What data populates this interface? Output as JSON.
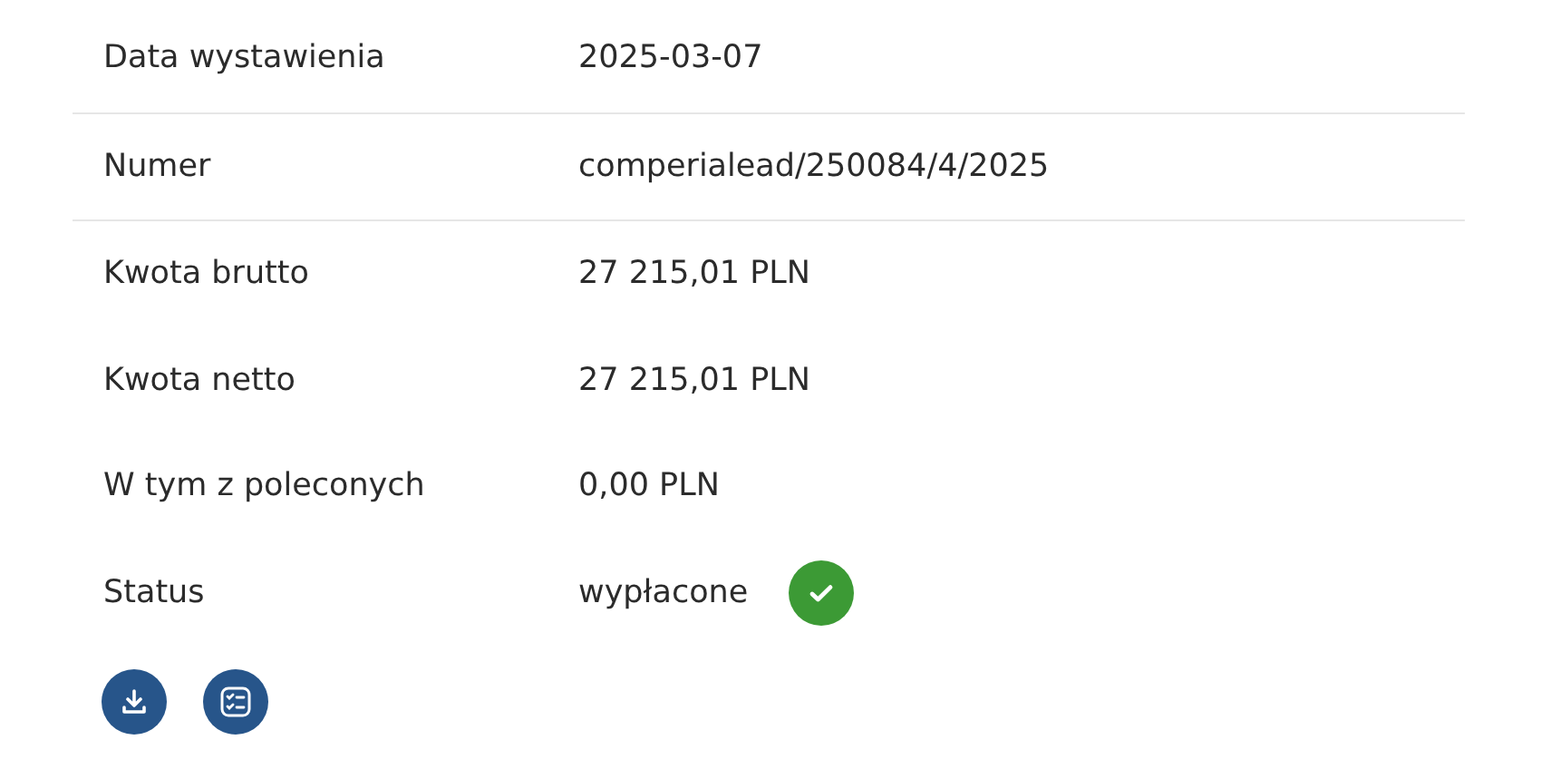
{
  "rows": [
    {
      "kind": "text",
      "label": "Data wystawienia",
      "value": "2025-03-07",
      "divider": true
    },
    {
      "kind": "text",
      "label": "Numer",
      "value": "comperialead/250084/4/2025",
      "divider": true
    },
    {
      "kind": "text",
      "label": "Kwota brutto",
      "value": "27 215,01 PLN",
      "divider": false
    },
    {
      "kind": "text",
      "label": "Kwota netto",
      "value": "27 215,01 PLN",
      "divider": false
    },
    {
      "kind": "text",
      "label": "W tym z poleconych",
      "value": "0,00 PLN",
      "divider": false
    },
    {
      "kind": "status",
      "label": "Status",
      "value": "wypłacone",
      "paid": true,
      "divider": false
    }
  ],
  "actions": [
    {
      "kind": "download"
    },
    {
      "kind": "checklist"
    }
  ]
}
